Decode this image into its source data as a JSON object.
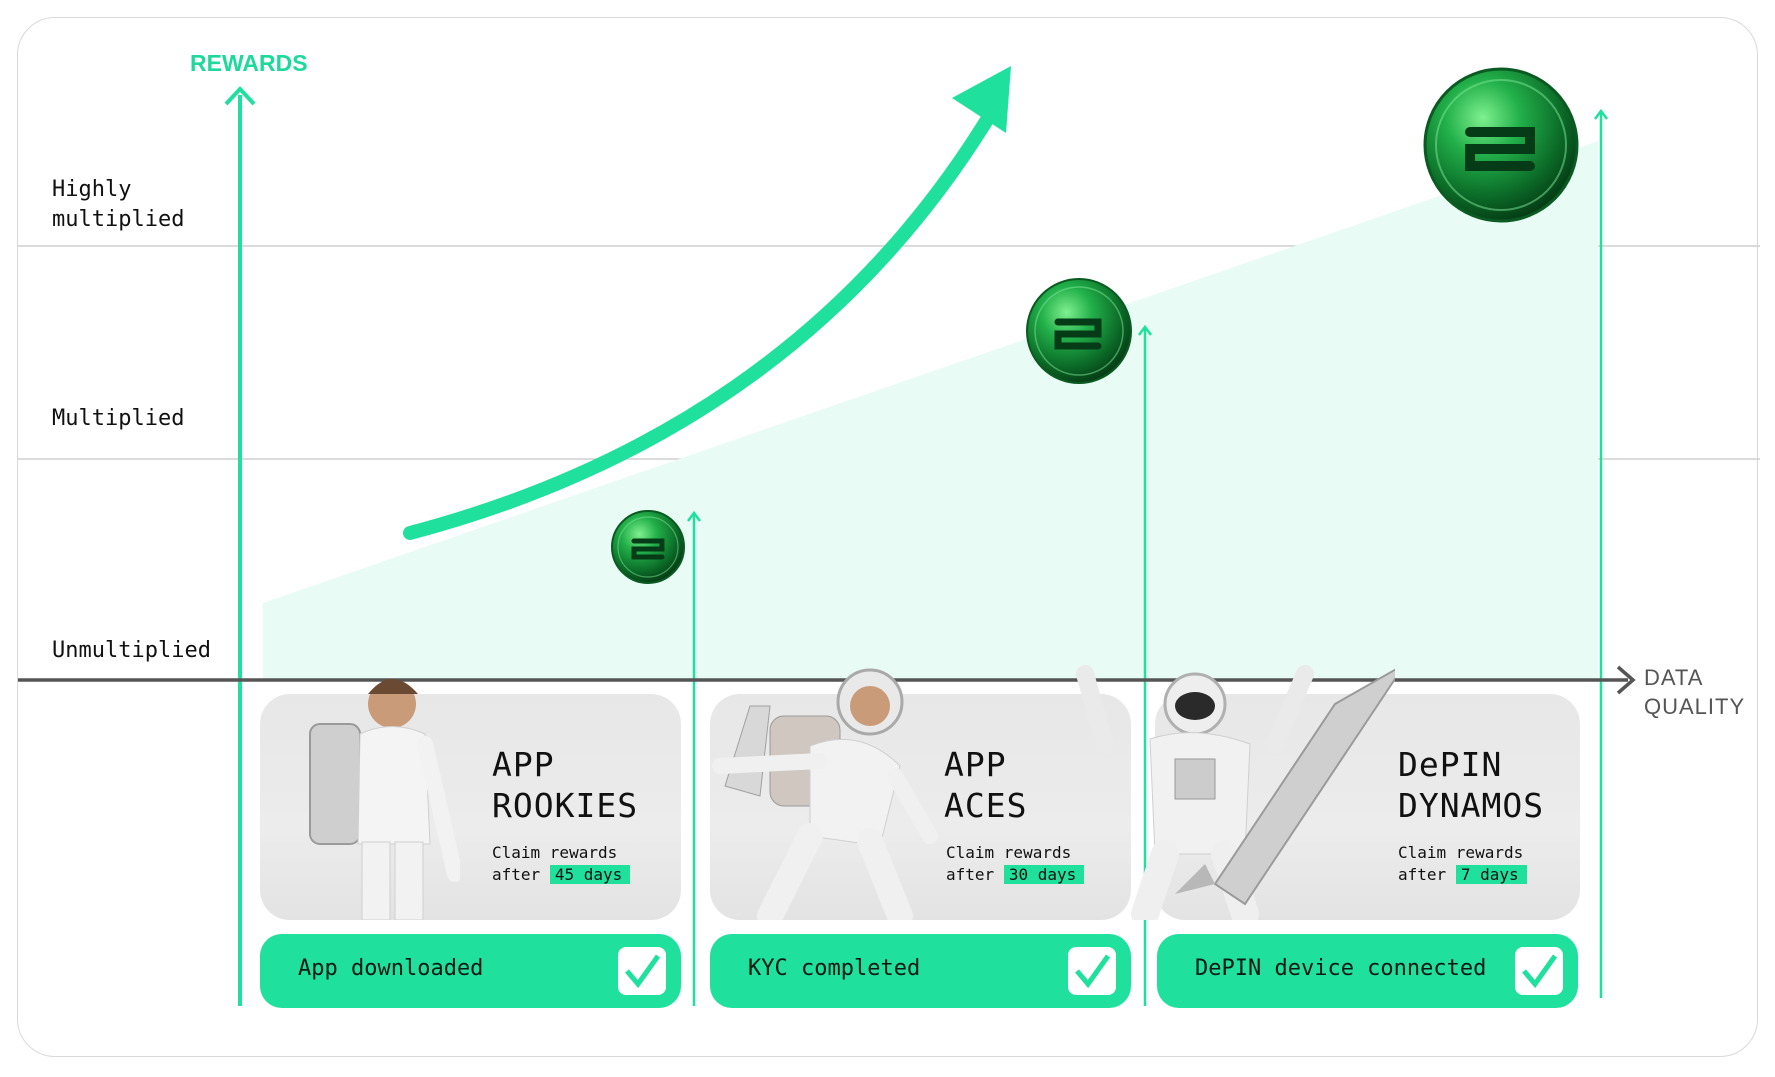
{
  "y_axis_label": "REWARDS",
  "x_axis_label": "DATA\nQUALITY",
  "levels": {
    "highly": "Highly\nmultiplied",
    "multiplied": "Multiplied",
    "unmultiplied": "Unmultiplied"
  },
  "tiers": [
    {
      "title": "APP\nROOKIES",
      "claim_line1": "Claim rewards",
      "claim_prefix": "after",
      "claim_days": "45 days",
      "step": "App downloaded",
      "figure_icon": "astronaut-jetpack-icon",
      "coin_icon": "small-coin-icon"
    },
    {
      "title": "APP\nACES",
      "claim_line1": "Claim rewards",
      "claim_prefix": "after",
      "claim_days": "30 days",
      "step": "KYC completed",
      "figure_icon": "astronaut-flying-icon",
      "coin_icon": "medium-coin-icon"
    },
    {
      "title": "DePIN\nDYNAMOS",
      "claim_line1": "Claim rewards",
      "claim_prefix": "after",
      "claim_days": "7 days",
      "step": "DePIN device connected",
      "figure_icon": "astronaut-rocket-icon",
      "coin_icon": "large-coin-icon"
    }
  ],
  "colors": {
    "accent": "#1fe09c",
    "area_fill": "#e8fbf4",
    "coin_green": "#149a3c",
    "axis_dark": "#555555"
  }
}
